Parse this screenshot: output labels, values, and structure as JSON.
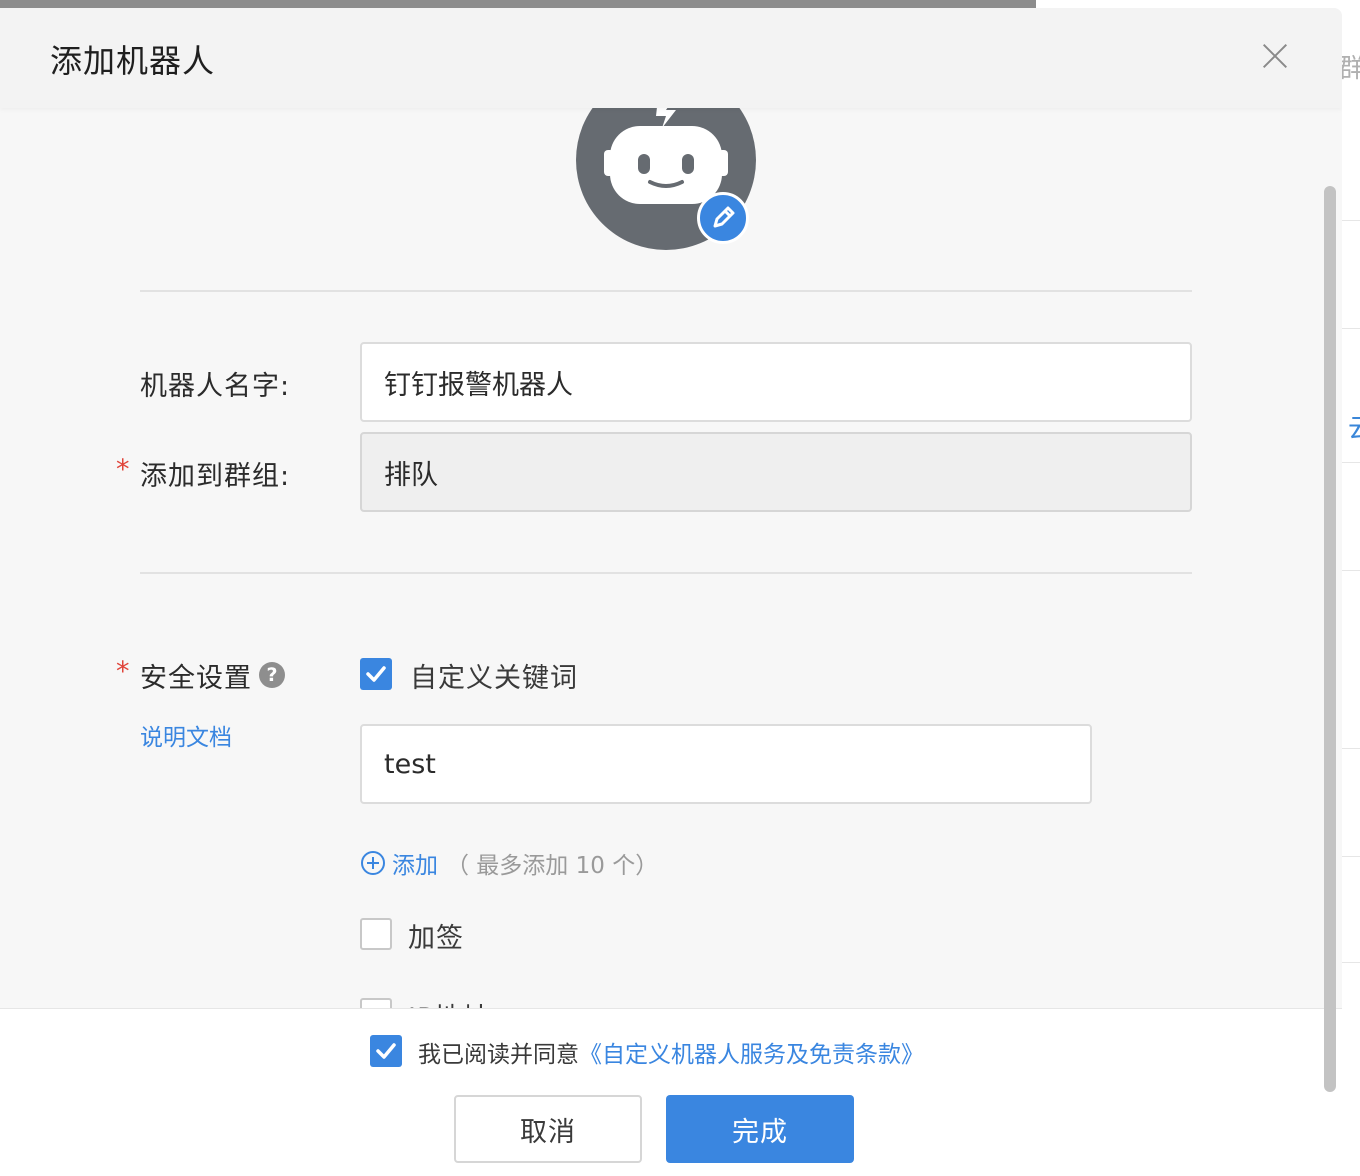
{
  "dialog": {
    "title": "添加机器人",
    "close_icon": "close-icon"
  },
  "avatar": {
    "icon": "robot-icon",
    "edit_icon": "pencil-icon"
  },
  "form": {
    "name_label": "机器人名字:",
    "name_value": "钉钉报警机器人",
    "group_required": "*",
    "group_label": "添加到群组:",
    "group_value": "排队"
  },
  "security": {
    "required": "*",
    "label": "安全设置",
    "help_icon": "?",
    "doc_link": "说明文档",
    "keyword_option": "自定义关键词",
    "keyword_checked": true,
    "keyword_value": "test",
    "add_label": "添加",
    "add_hint": "（ 最多添加 10 个）",
    "sign_option": "加签",
    "sign_checked": false,
    "ip_option": "IP地址（段）"
  },
  "footer": {
    "agree_checked": true,
    "agree_text": "我已阅读并同意",
    "agree_link": "《自定义机器人服务及免责条款》",
    "cancel_label": "取消",
    "done_label": "完成"
  },
  "backdrop": {
    "text_1": "群",
    "text_2": "云"
  },
  "colors": {
    "accent": "#3a86e0",
    "required": "#e0443a",
    "avatar_bg": "#666b71"
  }
}
